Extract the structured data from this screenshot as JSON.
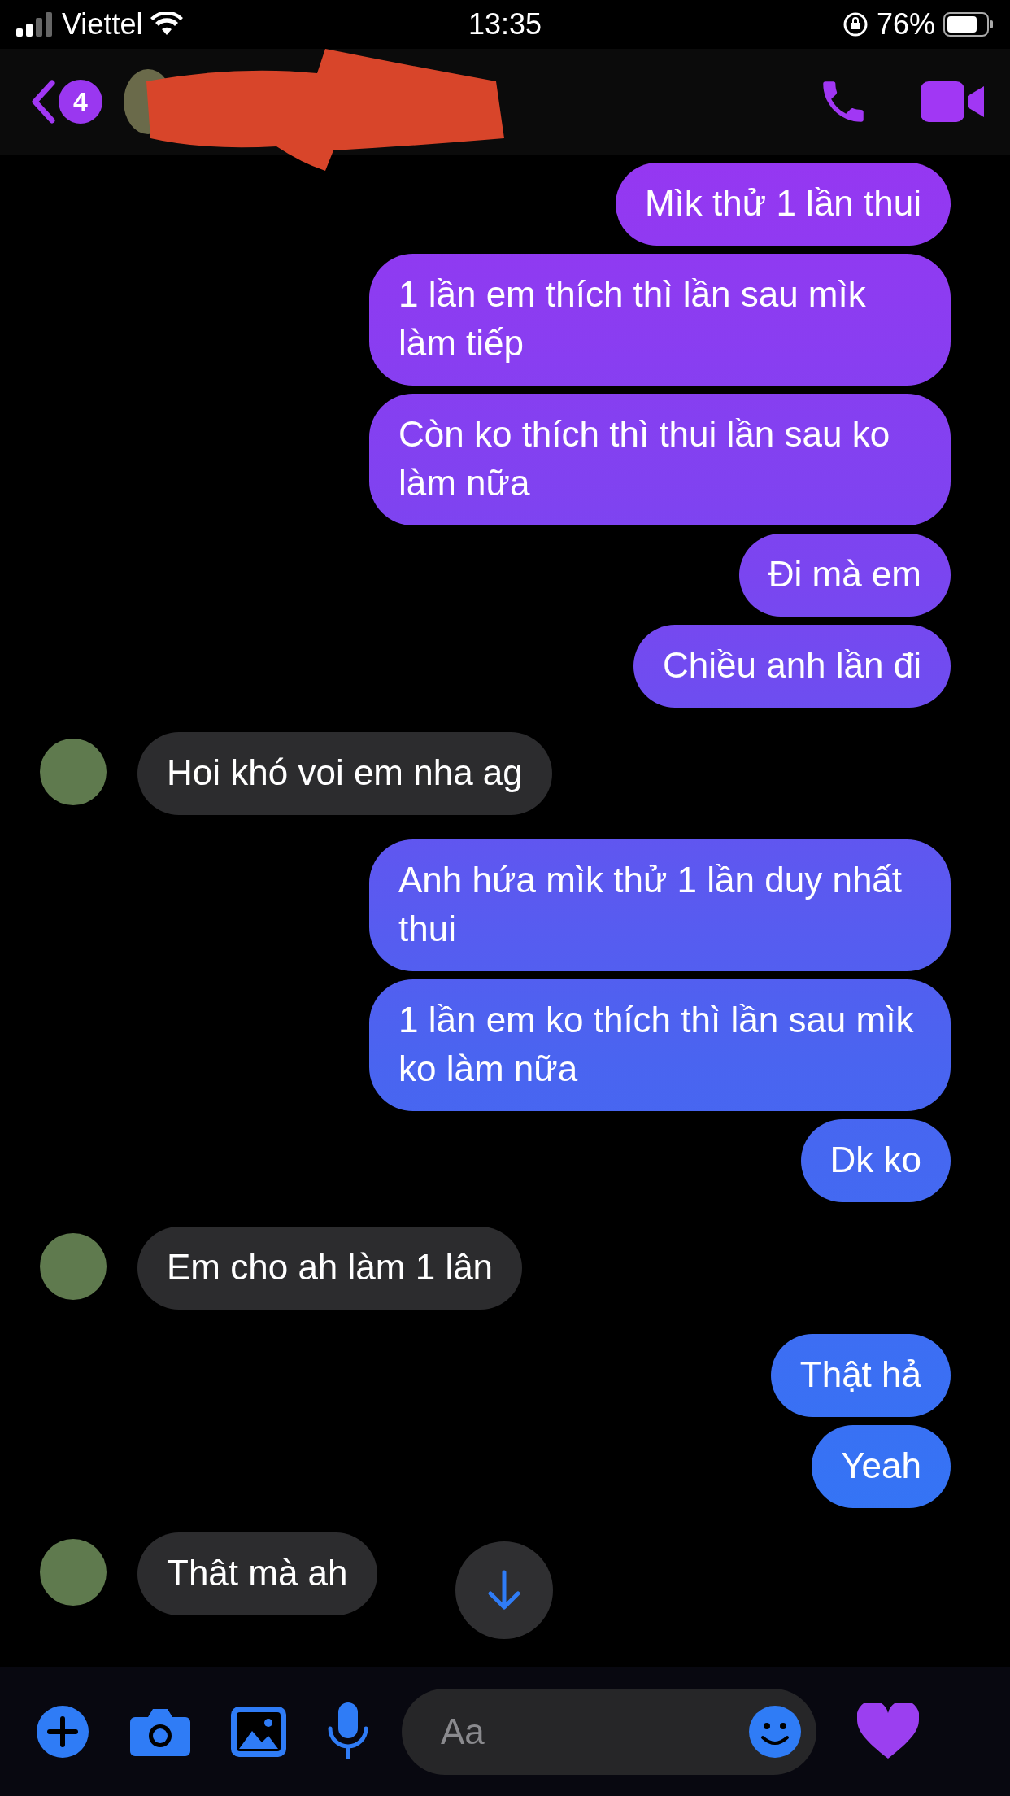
{
  "status_bar": {
    "carrier": "Viettel",
    "time": "13:35",
    "battery": "76%"
  },
  "header": {
    "unread_count": "4"
  },
  "messages": [
    {
      "kind": "sent",
      "text": "Mìk thử 1 lần thui"
    },
    {
      "kind": "sent",
      "text": "1 lần em thích thì lần sau mìk làm tiếp"
    },
    {
      "kind": "sent",
      "text": "Còn ko thích thì thui lần sau ko làm nữa"
    },
    {
      "kind": "sent",
      "text": "Đi mà em"
    },
    {
      "kind": "sent",
      "text": "Chiều anh lần đi"
    },
    {
      "kind": "received",
      "text": "Hoi khó voi em nha ag"
    },
    {
      "kind": "sent",
      "text": "Anh hứa mìk thử 1 lần duy nhất thui"
    },
    {
      "kind": "sent",
      "text": "1 lần em ko thích thì lần sau mìk ko làm nữa"
    },
    {
      "kind": "sent",
      "text": "Dk ko"
    },
    {
      "kind": "received",
      "text": "Em cho ah làm 1 lân"
    },
    {
      "kind": "sent",
      "text": "Thật hả"
    },
    {
      "kind": "sent",
      "text": "Yeah"
    },
    {
      "kind": "received",
      "text": "Thât mà ah"
    }
  ],
  "composer": {
    "placeholder": "Aa"
  }
}
